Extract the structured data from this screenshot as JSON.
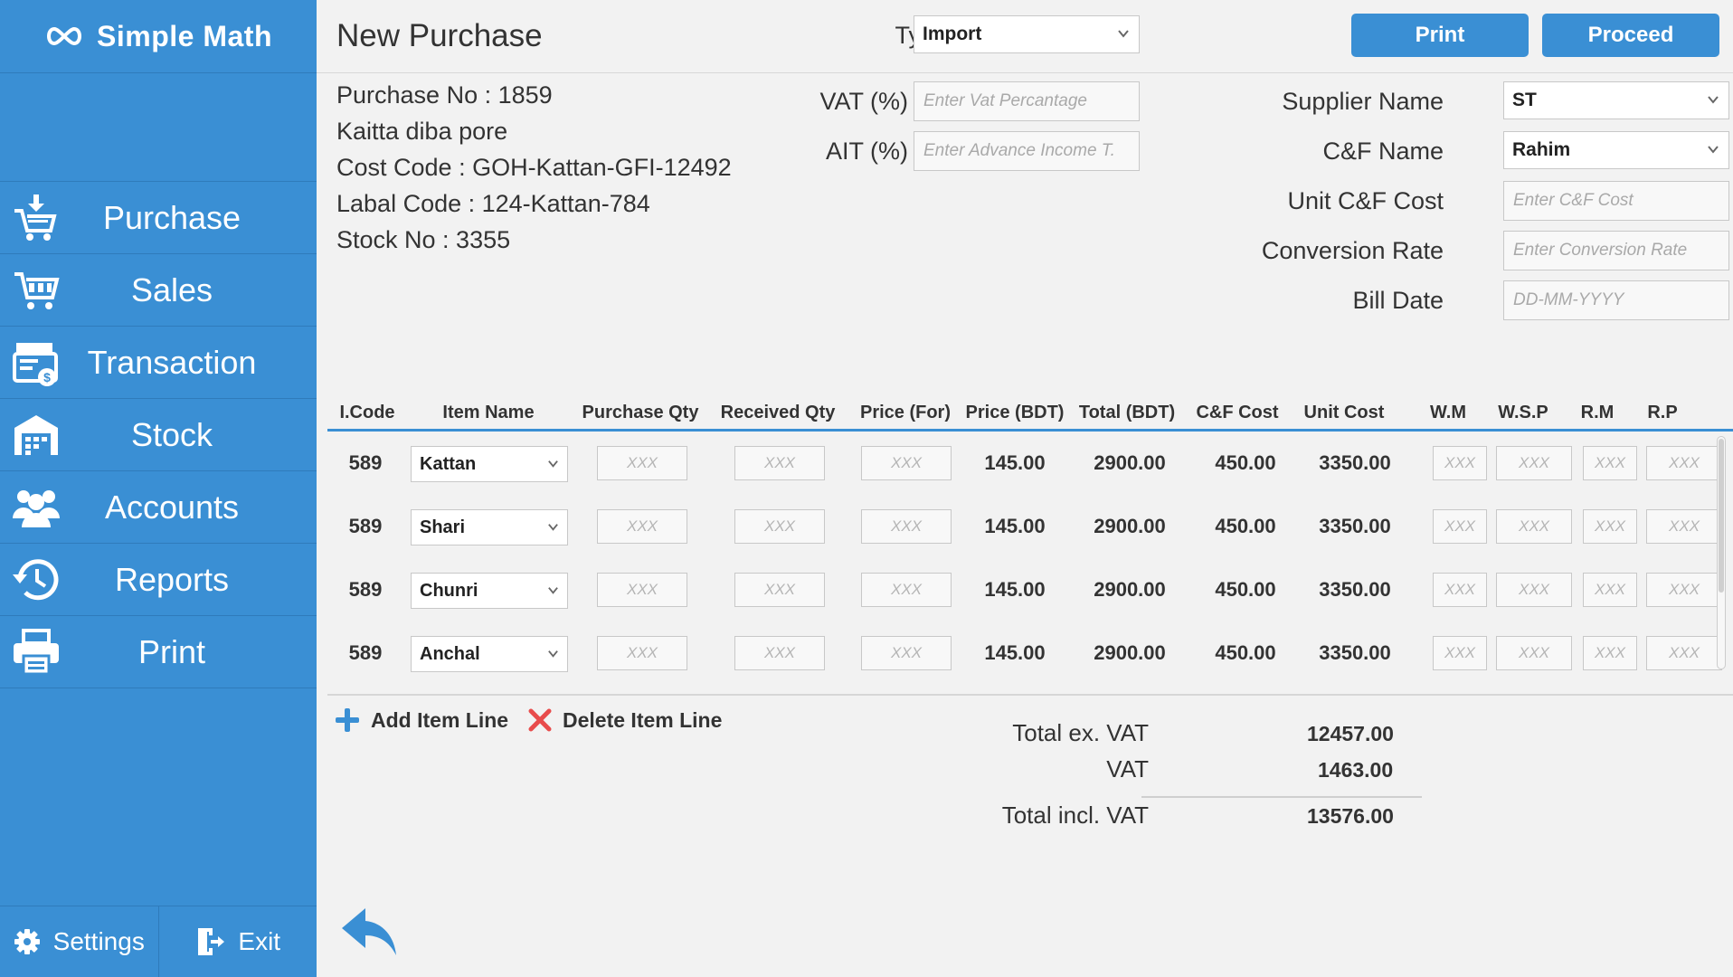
{
  "app": {
    "name": "Simple Math"
  },
  "sidebar": {
    "items": [
      {
        "label": "Purchase",
        "icon": "cart-download-icon"
      },
      {
        "label": "Sales",
        "icon": "cart-icon"
      },
      {
        "label": "Transaction",
        "icon": "cash-register-icon"
      },
      {
        "label": "Stock",
        "icon": "warehouse-icon"
      },
      {
        "label": "Accounts",
        "icon": "users-icon"
      },
      {
        "label": "Reports",
        "icon": "history-icon"
      },
      {
        "label": "Print",
        "icon": "printer-icon"
      }
    ],
    "settings_label": "Settings",
    "exit_label": "Exit"
  },
  "header": {
    "title": "New Purchase",
    "type_label": "Type",
    "type_value": "Import",
    "print_label": "Print",
    "proceed_label": "Proceed"
  },
  "info": {
    "purchase_no": "Purchase No : 1859",
    "note": "Kaitta diba pore",
    "cost_code": "Cost Code : GOH-Kattan-GFI-12492",
    "label_code": "Labal Code : 124-Kattan-784",
    "stock_no": "Stock No : 3355"
  },
  "tax": {
    "vat_label": "VAT (%)",
    "vat_placeholder": "Enter Vat Percantage",
    "ait_label": "AIT (%)",
    "ait_placeholder": "Enter Advance Income T."
  },
  "supplier": {
    "supplier_label": "Supplier Name",
    "supplier_value": "ST",
    "cf_label": "C&F Name",
    "cf_value": "Rahim",
    "unit_cf_label": "Unit C&F Cost",
    "unit_cf_placeholder": "Enter C&F Cost",
    "conv_label": "Conversion Rate",
    "conv_placeholder": "Enter Conversion Rate",
    "bill_label": "Bill Date",
    "bill_placeholder": "DD-MM-YYYY"
  },
  "table": {
    "headers": [
      "I.Code",
      "Item Name",
      "Purchase Qty",
      "Received Qty",
      "Price (For)",
      "Price (BDT)",
      "Total (BDT)",
      "C&F Cost",
      "Unit Cost",
      "W.M",
      "W.S.P",
      "R.M",
      "R.P"
    ],
    "placeholder": "XXX",
    "rows": [
      {
        "code": "589",
        "item": "Kattan",
        "price_bdt": "145.00",
        "total_bdt": "2900.00",
        "cf_cost": "450.00",
        "unit_cost": "3350.00"
      },
      {
        "code": "589",
        "item": "Shari",
        "price_bdt": "145.00",
        "total_bdt": "2900.00",
        "cf_cost": "450.00",
        "unit_cost": "3350.00"
      },
      {
        "code": "589",
        "item": "Chunri",
        "price_bdt": "145.00",
        "total_bdt": "2900.00",
        "cf_cost": "450.00",
        "unit_cost": "3350.00"
      },
      {
        "code": "589",
        "item": "Anchal",
        "price_bdt": "145.00",
        "total_bdt": "2900.00",
        "cf_cost": "450.00",
        "unit_cost": "3350.00"
      }
    ]
  },
  "actions": {
    "add_label": "Add Item Line",
    "delete_label": "Delete Item Line"
  },
  "totals": {
    "ex_vat_label": "Total ex. VAT",
    "ex_vat_value": "12457.00",
    "vat_label": "VAT",
    "vat_value": "1463.00",
    "incl_vat_label": "Total incl. VAT",
    "incl_vat_value": "13576.00"
  },
  "colors": {
    "accent": "#3a8fd4",
    "delete": "#e84c4c"
  }
}
